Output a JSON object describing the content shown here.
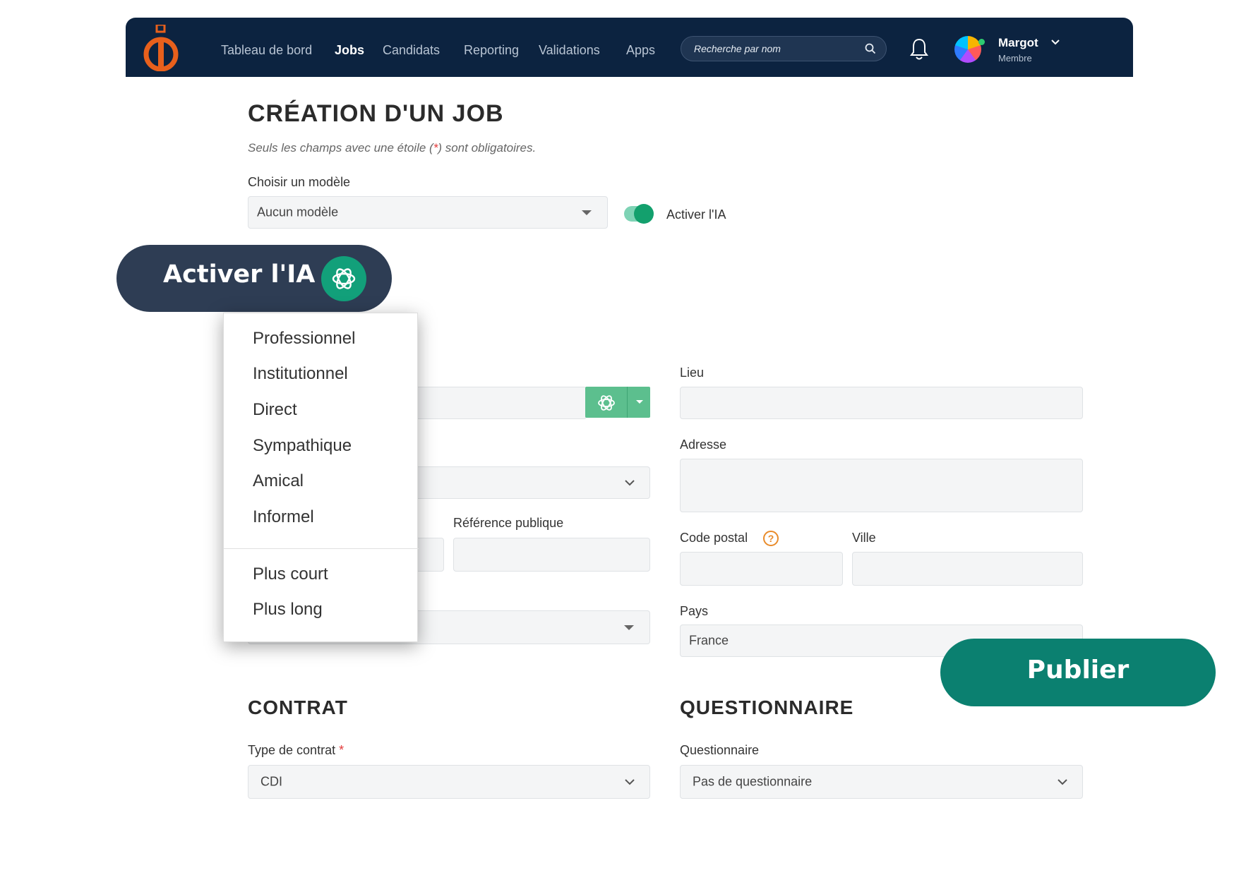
{
  "nav": {
    "items": [
      "Tableau de bord",
      "Jobs",
      "Candidats",
      "Reporting",
      "Validations",
      "Apps"
    ],
    "active": "Jobs",
    "search_placeholder": "Recherche par nom",
    "user": {
      "name": "Margot",
      "role": "Membre"
    }
  },
  "page": {
    "title": "CRÉATION D'UN JOB",
    "subtitle_before": "Seuls les champs avec une étoile (",
    "subtitle_star": "*",
    "subtitle_after": ") sont obligatoires."
  },
  "model": {
    "label": "Choisir un modèle",
    "value": "Aucun modèle"
  },
  "ai_toggle": {
    "label": "Activer l'IA",
    "on": true
  },
  "ai_pill": {
    "label": "Activer l'IA"
  },
  "tone_menu": {
    "tones": [
      "Professionnel",
      "Institutionnel",
      "Direct",
      "Sympathique",
      "Amical",
      "Informel"
    ],
    "lengths": [
      "Plus court",
      "Plus long"
    ]
  },
  "form": {
    "lieu_label": "Lieu",
    "adresse_label": "Adresse",
    "ref_label": "Référence publique",
    "code_postal_label": "Code postal",
    "ville_label": "Ville",
    "pays_label": "Pays",
    "pays_value": "France"
  },
  "contrat": {
    "section_title": "CONTRAT",
    "type_label": "Type de contrat",
    "type_value": "CDI"
  },
  "questionnaire": {
    "section_title": "QUESTIONNAIRE",
    "label": "Questionnaire",
    "value": "Pas de questionnaire"
  },
  "publish_label": "Publier",
  "colors": {
    "nav_bg": "#0c2340",
    "accent_green": "#13a06d",
    "publish_bg": "#0b8070",
    "pill_bg": "#2e3d54",
    "logo_orange": "#e8601c"
  }
}
